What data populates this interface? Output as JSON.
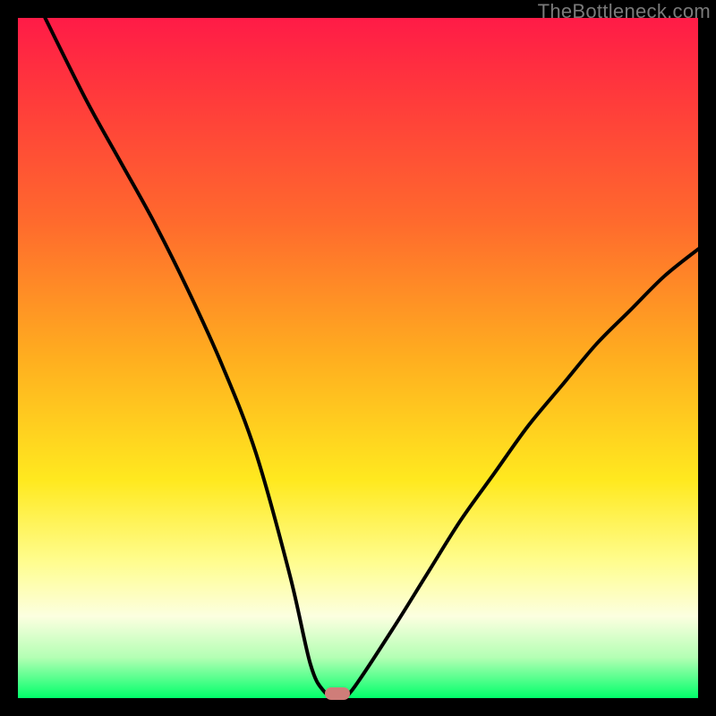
{
  "watermark": "TheBottleneck.com",
  "marker": {
    "x_pct": 47,
    "y_pct": 99.3
  },
  "chart_data": {
    "type": "line",
    "title": "",
    "xlabel": "",
    "ylabel": "",
    "xlim": [
      0,
      100
    ],
    "ylim": [
      0,
      100
    ],
    "grid": false,
    "series": [
      {
        "name": "bottleneck-curve",
        "x": [
          4,
          10,
          15,
          20,
          25,
          30,
          35,
          40,
          43,
          45,
          47,
          49,
          55,
          60,
          65,
          70,
          75,
          80,
          85,
          90,
          95,
          100
        ],
        "y": [
          100,
          88,
          79,
          70,
          60,
          49,
          36,
          18,
          5,
          1,
          0,
          1,
          10,
          18,
          26,
          33,
          40,
          46,
          52,
          57,
          62,
          66
        ]
      }
    ],
    "annotations": [
      {
        "type": "marker",
        "x": 47,
        "y": 0.7,
        "shape": "pill",
        "color": "#cf7d79"
      }
    ],
    "background_gradient": {
      "direction": "vertical",
      "stops": [
        {
          "pos": 0.0,
          "color": "#ff1b47"
        },
        {
          "pos": 0.12,
          "color": "#ff3b3b"
        },
        {
          "pos": 0.3,
          "color": "#ff6a2d"
        },
        {
          "pos": 0.5,
          "color": "#ffae1f"
        },
        {
          "pos": 0.68,
          "color": "#ffe91f"
        },
        {
          "pos": 0.8,
          "color": "#fffd8f"
        },
        {
          "pos": 0.88,
          "color": "#fcffe0"
        },
        {
          "pos": 0.94,
          "color": "#b4ffb4"
        },
        {
          "pos": 1.0,
          "color": "#00ff6a"
        }
      ]
    }
  }
}
